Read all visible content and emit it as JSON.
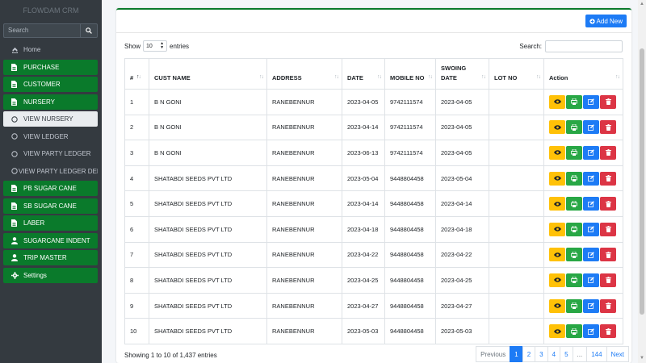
{
  "sidebar": {
    "brand": "FLOWDAM CRM",
    "search_placeholder": "Search",
    "items": [
      {
        "label": "Home",
        "type": "plain",
        "icon": "speedometer-icon"
      },
      {
        "label": "PURCHASE",
        "type": "green",
        "icon": "file-icon"
      },
      {
        "label": "CUSTOMER",
        "type": "green",
        "icon": "file-icon"
      },
      {
        "label": "NURSERY",
        "type": "green",
        "icon": "file-icon"
      },
      {
        "label": "VIEW NURSERY",
        "type": "active",
        "icon": "circle-icon"
      },
      {
        "label": "VIEW LEDGER",
        "type": "plain",
        "icon": "circle-icon"
      },
      {
        "label": "VIEW PARTY LEDGER",
        "type": "plain",
        "icon": "circle-icon"
      },
      {
        "label": "VIEW PARTY LEDGER DELE",
        "type": "plain",
        "icon": "circle-icon"
      },
      {
        "label": "PB SUGAR CANE",
        "type": "green",
        "icon": "file-icon"
      },
      {
        "label": "SB SUGAR CANE",
        "type": "green",
        "icon": "file-icon"
      },
      {
        "label": "LABER",
        "type": "green",
        "icon": "file-icon"
      },
      {
        "label": "SUGARCANE INDENT",
        "type": "green",
        "icon": "user-icon"
      },
      {
        "label": "TRIP MASTER",
        "type": "green",
        "icon": "user-icon"
      },
      {
        "label": "Settings",
        "type": "green",
        "icon": "gear-icon"
      }
    ]
  },
  "header": {
    "add_label": "Add New"
  },
  "controls": {
    "show_label": "Show",
    "entries_value": "10",
    "entries_label": "entries",
    "search_label": "Search:"
  },
  "table": {
    "columns": [
      {
        "label": "#",
        "sort_active": true
      },
      {
        "label": "CUST NAME",
        "sort_active": false
      },
      {
        "label": "ADDRESS",
        "sort_active": false
      },
      {
        "label": "DATE",
        "sort_active": false
      },
      {
        "label": "MOBILE NO",
        "sort_active": false
      },
      {
        "label": "SWOING DATE",
        "sort_active": false
      },
      {
        "label": "LOT NO",
        "sort_active": false
      },
      {
        "label": "Action",
        "sort_active": false
      }
    ],
    "rows": [
      {
        "no": "1",
        "name": "B N GONI",
        "address": "RANEBENNUR",
        "date": "2023-04-05",
        "mobile": "9742111574",
        "sowing": "2023-04-05",
        "lot": ""
      },
      {
        "no": "2",
        "name": "B N GONI",
        "address": "RANEBENNUR",
        "date": "2023-04-14",
        "mobile": "9742111574",
        "sowing": "2023-04-05",
        "lot": ""
      },
      {
        "no": "3",
        "name": "B N GONI",
        "address": "RANEBENNUR",
        "date": "2023-06-13",
        "mobile": "9742111574",
        "sowing": "2023-04-05",
        "lot": ""
      },
      {
        "no": "4",
        "name": "SHATABDI SEEDS PVT LTD",
        "address": "RANEBENNUR",
        "date": "2023-05-04",
        "mobile": "9448804458",
        "sowing": "2023-05-04",
        "lot": ""
      },
      {
        "no": "5",
        "name": "SHATABDI SEEDS PVT LTD",
        "address": "RANEBENNUR",
        "date": "2023-04-14",
        "mobile": "9448804458",
        "sowing": "2023-04-14",
        "lot": ""
      },
      {
        "no": "6",
        "name": "SHATABDI SEEDS PVT LTD",
        "address": "RANEBENNUR",
        "date": "2023-04-18",
        "mobile": "9448804458",
        "sowing": "2023-04-18",
        "lot": ""
      },
      {
        "no": "7",
        "name": "SHATABDI SEEDS PVT LTD",
        "address": "RANEBENNUR",
        "date": "2023-04-22",
        "mobile": "9448804458",
        "sowing": "2023-04-22",
        "lot": ""
      },
      {
        "no": "8",
        "name": "SHATABDI SEEDS PVT LTD",
        "address": "RANEBENNUR",
        "date": "2023-04-25",
        "mobile": "9448804458",
        "sowing": "2023-04-25",
        "lot": ""
      },
      {
        "no": "9",
        "name": "SHATABDI SEEDS PVT LTD",
        "address": "RANEBENNUR",
        "date": "2023-04-27",
        "mobile": "9448804458",
        "sowing": "2023-04-27",
        "lot": ""
      },
      {
        "no": "10",
        "name": "SHATABDI SEEDS PVT LTD",
        "address": "RANEBENNUR",
        "date": "2023-05-03",
        "mobile": "9448804458",
        "sowing": "2023-05-03",
        "lot": ""
      }
    ]
  },
  "footer": {
    "info": "Showing 1 to 10 of 1,437 entries",
    "pages": [
      "Previous",
      "1",
      "2",
      "3",
      "4",
      "5",
      "...",
      "144",
      "Next"
    ],
    "current_page": "1"
  },
  "colors": {
    "sidebar_bg": "#343a40",
    "green": "#0a7a2b",
    "primary": "#1d7bf5",
    "warning": "#ffc107",
    "success": "#28a745",
    "danger": "#dc3545"
  }
}
